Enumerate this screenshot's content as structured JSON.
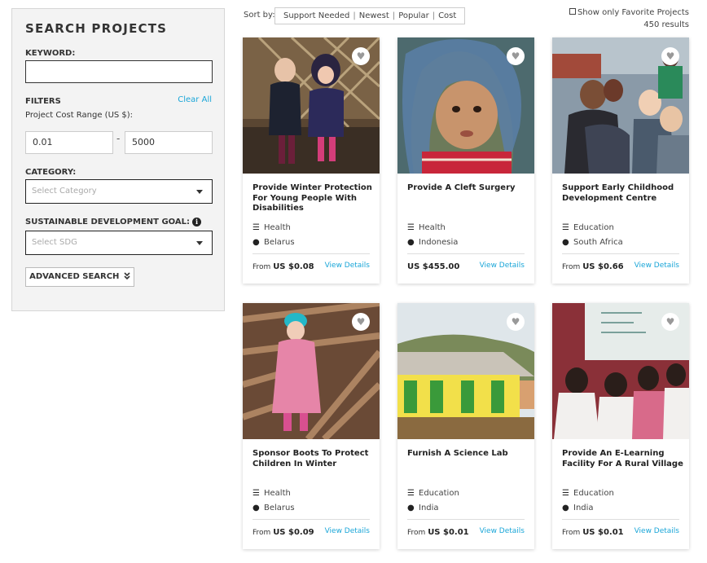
{
  "sidebar": {
    "title": "SEARCH PROJECTS",
    "keyword_label": "KEYWORD:",
    "keyword_value": "",
    "filters_label": "FILTERS",
    "clear_all": "Clear All",
    "range_label": "Project Cost Range (US $):",
    "range_min": "0.01",
    "range_max": "5000",
    "range_sep": "-",
    "category_label": "CATEGORY:",
    "category_placeholder": "Select Category",
    "sdg_label": "SUSTAINABLE DEVELOPMENT GOAL:",
    "sdg_placeholder": "Select SDG",
    "advanced_search": "ADVANCED SEARCH"
  },
  "sort": {
    "label": "Sort by:",
    "options": [
      "Support Needed",
      "Newest",
      "Popular",
      "Cost"
    ],
    "sep": "|"
  },
  "favorites_label": "Show only Favorite Projects",
  "results_count": "450 results",
  "icons": {
    "heart": "heart-icon",
    "category": "list-icon",
    "location": "map-pin-icon",
    "info": "info-icon",
    "advanced": "double-chevron-down-icon"
  },
  "colors": {
    "link": "#1aa6d8",
    "sidebar_bg": "#f3f3f3"
  },
  "cards": [
    {
      "title": "Provide Winter Protection For Young People With Disabilities",
      "category": "Health",
      "location": "Belarus",
      "price_prefix": "From",
      "price": "US $0.08",
      "link": "View Details"
    },
    {
      "title": "Provide A Cleft Surgery",
      "category": "Health",
      "location": "Indonesia",
      "price_prefix": "",
      "price": "US $455.00",
      "link": "View Details"
    },
    {
      "title": "Support Early Childhood Development Centre",
      "category": "Education",
      "location": "South Africa",
      "price_prefix": "From",
      "price": "US $0.66",
      "link": "View Details"
    },
    {
      "title": "Sponsor Boots To Protect Children In Winter",
      "category": "Health",
      "location": "Belarus",
      "price_prefix": "From",
      "price": "US $0.09",
      "link": "View Details"
    },
    {
      "title": "Furnish A Science Lab",
      "category": "Education",
      "location": "India",
      "price_prefix": "From",
      "price": "US $0.01",
      "link": "View Details"
    },
    {
      "title": "Provide An E-Learning Facility For A Rural Village",
      "category": "Education",
      "location": "India",
      "price_prefix": "From",
      "price": "US $0.01",
      "link": "View Details"
    }
  ]
}
